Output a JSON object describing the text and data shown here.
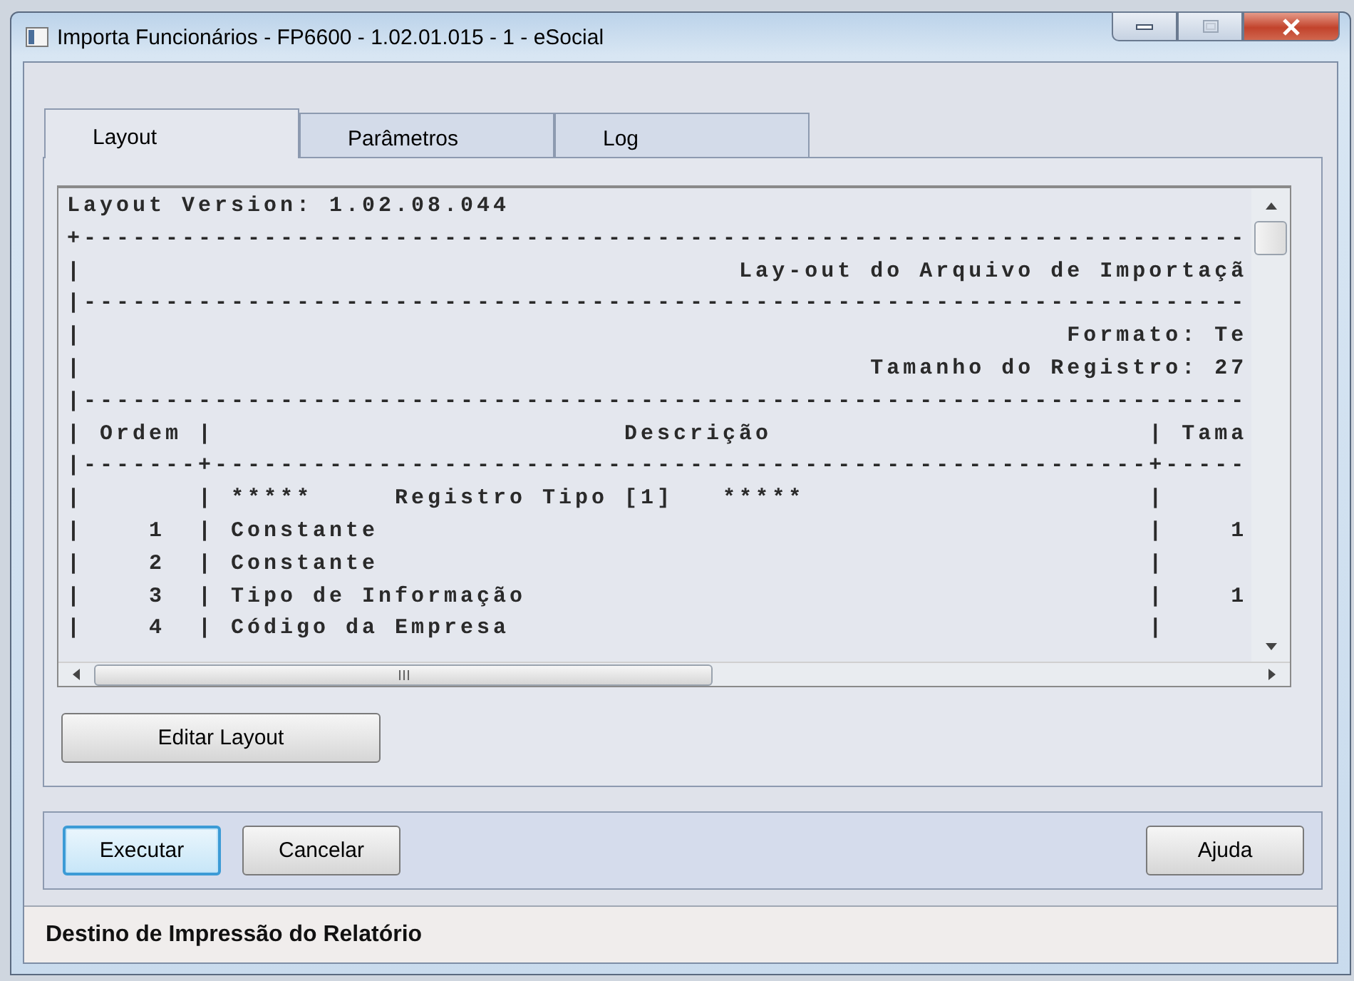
{
  "window": {
    "title": "Importa Funcionários - FP6600 - 1.02.01.015 - 1 - eSocial"
  },
  "tabs": [
    {
      "label": "Layout",
      "selected": true
    },
    {
      "label": "Parâmetros",
      "selected": false
    },
    {
      "label": "Log",
      "selected": false
    }
  ],
  "layout_text": {
    "lines": [
      "Layout Version: 1.02.08.044",
      "+-----------------------------------------------------------------------",
      "|                                        Lay-out do Arquivo de Importaçã",
      "|-----------------------------------------------------------------------",
      "|                                                            Formato: Te",
      "|                                                Tamanho do Registro: 27",
      "|-----------------------------------------------------------------------",
      "| Ordem |                         Descrição                       | Tama",
      "|-------+---------------------------------------------------------+-----",
      "|       | *****     Registro Tipo [1]   *****                     |",
      "|    1  | Constante                                               |    1",
      "|    2  | Constante                                               |",
      "|    3  | Tipo de Informação                                      |    1",
      "|    4  | Código da Empresa                                       |"
    ]
  },
  "edit_button": {
    "label": "Editar Layout"
  },
  "buttons": [
    {
      "label": "Executar",
      "focused": true
    },
    {
      "label": "Cancelar",
      "focused": false
    }
  ],
  "help_button": {
    "label": "Ajuda",
    "focused": false
  },
  "status_bar": {
    "text": "Destino de Impressão do Relatório"
  }
}
